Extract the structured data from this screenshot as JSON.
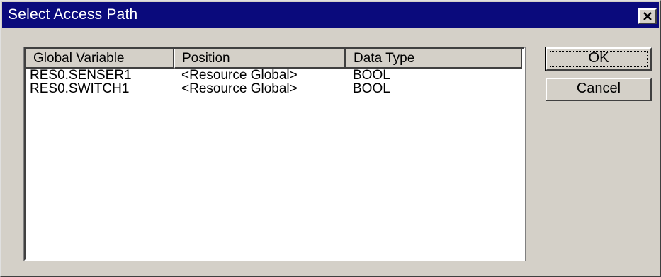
{
  "dialog": {
    "title": "Select Access Path",
    "close_icon": "close-icon"
  },
  "list": {
    "columns": [
      "Global Variable",
      "Position",
      "Data Type"
    ],
    "rows": [
      [
        "RES0.SENSER1",
        "<Resource Global>",
        "BOOL"
      ],
      [
        "RES0.SWITCH1",
        "<Resource Global>",
        "BOOL"
      ]
    ]
  },
  "buttons": {
    "ok_label": "OK",
    "cancel_label": "Cancel"
  },
  "colors": {
    "titlebar": "#0a0a7c",
    "face": "#d4d0c8"
  }
}
